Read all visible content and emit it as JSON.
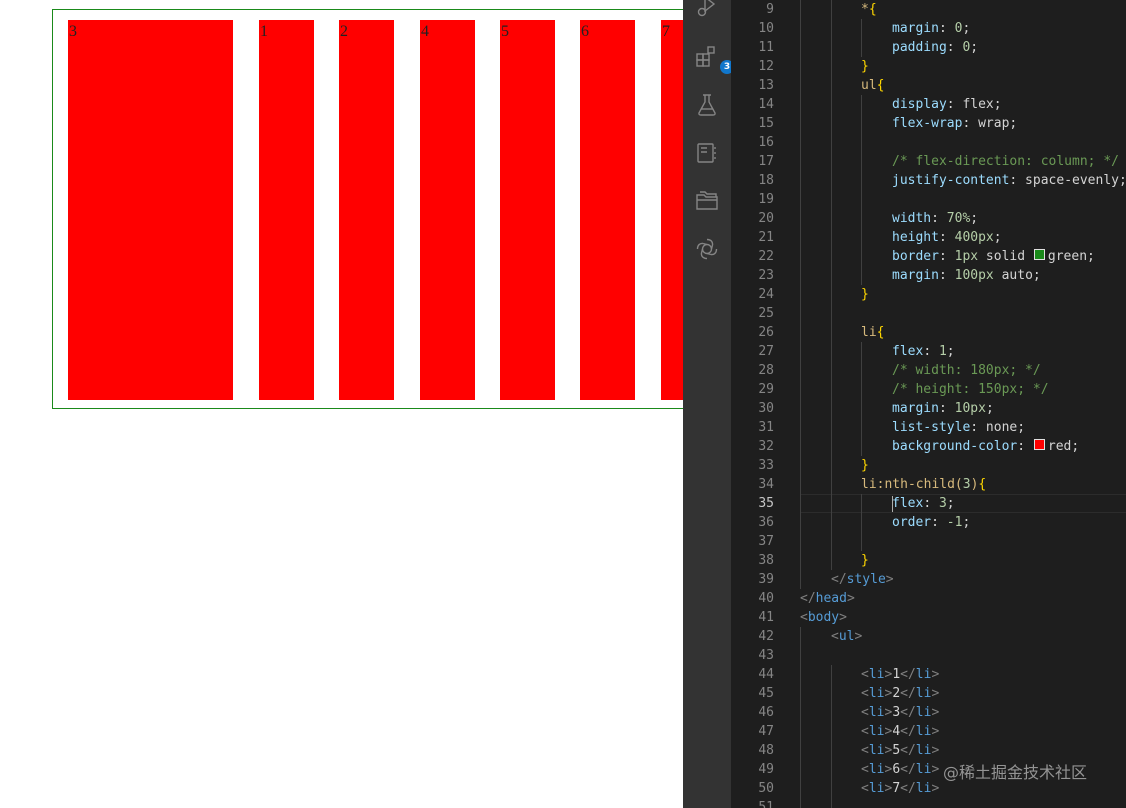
{
  "preview": {
    "items": [
      {
        "label": "3",
        "flex": 3
      },
      {
        "label": "1",
        "flex": 1
      },
      {
        "label": "2",
        "flex": 1
      },
      {
        "label": "4",
        "flex": 1
      },
      {
        "label": "5",
        "flex": 1
      },
      {
        "label": "6",
        "flex": 1
      },
      {
        "label": "7",
        "flex": 1
      }
    ],
    "colors": {
      "item_bg": "#ff0000",
      "border": "#1a8a1a"
    }
  },
  "activity_bar": {
    "icons": [
      "run-debug-icon",
      "extensions-icon",
      "testing-flask-icon",
      "notebook-icon",
      "folder-explorer-icon",
      "openai-chat-icon"
    ],
    "extensions_badge": "3"
  },
  "editor": {
    "active_line": 35,
    "lines": [
      {
        "n": "9",
        "indent": 2,
        "tokens": [
          [
            "sel",
            "*"
          ],
          [
            "brace",
            "{"
          ]
        ]
      },
      {
        "n": "10",
        "indent": 3,
        "tokens": [
          [
            "prop",
            "margin"
          ],
          [
            "val",
            ": "
          ],
          [
            "num",
            "0"
          ],
          [
            "val",
            ";"
          ]
        ]
      },
      {
        "n": "11",
        "indent": 3,
        "tokens": [
          [
            "prop",
            "padding"
          ],
          [
            "val",
            ": "
          ],
          [
            "num",
            "0"
          ],
          [
            "val",
            ";"
          ]
        ]
      },
      {
        "n": "12",
        "indent": 2,
        "tokens": [
          [
            "brace",
            "}"
          ]
        ]
      },
      {
        "n": "13",
        "indent": 2,
        "tokens": [
          [
            "sel",
            "ul"
          ],
          [
            "brace",
            "{"
          ]
        ]
      },
      {
        "n": "14",
        "indent": 3,
        "tokens": [
          [
            "prop",
            "display"
          ],
          [
            "val",
            ": flex;"
          ]
        ]
      },
      {
        "n": "15",
        "indent": 3,
        "tokens": [
          [
            "prop",
            "flex-wrap"
          ],
          [
            "val",
            ": wrap;"
          ]
        ]
      },
      {
        "n": "16",
        "indent": 3,
        "tokens": []
      },
      {
        "n": "17",
        "indent": 3,
        "tokens": [
          [
            "com",
            "/* flex-direction: column; */"
          ]
        ]
      },
      {
        "n": "18",
        "indent": 3,
        "tokens": [
          [
            "prop",
            "justify-content"
          ],
          [
            "val",
            ": space-evenly;"
          ]
        ]
      },
      {
        "n": "19",
        "indent": 3,
        "tokens": []
      },
      {
        "n": "20",
        "indent": 3,
        "tokens": [
          [
            "prop",
            "width"
          ],
          [
            "val",
            ": "
          ],
          [
            "num",
            "70%"
          ],
          [
            "val",
            ";"
          ]
        ]
      },
      {
        "n": "21",
        "indent": 3,
        "tokens": [
          [
            "prop",
            "height"
          ],
          [
            "val",
            ": "
          ],
          [
            "num",
            "400px"
          ],
          [
            "val",
            ";"
          ]
        ]
      },
      {
        "n": "22",
        "indent": 3,
        "tokens": [
          [
            "prop",
            "border"
          ],
          [
            "val",
            ": "
          ],
          [
            "num",
            "1px"
          ],
          [
            "val",
            " solid "
          ],
          [
            "swatch",
            "#1a8a1a"
          ],
          [
            "val",
            "green;"
          ]
        ]
      },
      {
        "n": "23",
        "indent": 3,
        "tokens": [
          [
            "prop",
            "margin"
          ],
          [
            "val",
            ": "
          ],
          [
            "num",
            "100px"
          ],
          [
            "val",
            " auto;"
          ]
        ]
      },
      {
        "n": "24",
        "indent": 2,
        "tokens": [
          [
            "brace",
            "}"
          ]
        ]
      },
      {
        "n": "25",
        "indent": 2,
        "tokens": []
      },
      {
        "n": "26",
        "indent": 2,
        "tokens": [
          [
            "sel",
            "li"
          ],
          [
            "brace",
            "{"
          ]
        ]
      },
      {
        "n": "27",
        "indent": 3,
        "tokens": [
          [
            "prop",
            "flex"
          ],
          [
            "val",
            ": "
          ],
          [
            "num",
            "1"
          ],
          [
            "val",
            ";"
          ]
        ]
      },
      {
        "n": "28",
        "indent": 3,
        "tokens": [
          [
            "com",
            "/* width: 180px; */"
          ]
        ]
      },
      {
        "n": "29",
        "indent": 3,
        "tokens": [
          [
            "com",
            "/* height: 150px; */"
          ]
        ]
      },
      {
        "n": "30",
        "indent": 3,
        "tokens": [
          [
            "prop",
            "margin"
          ],
          [
            "val",
            ": "
          ],
          [
            "num",
            "10px"
          ],
          [
            "val",
            ";"
          ]
        ]
      },
      {
        "n": "31",
        "indent": 3,
        "tokens": [
          [
            "prop",
            "list-style"
          ],
          [
            "val",
            ": none;"
          ]
        ]
      },
      {
        "n": "32",
        "indent": 3,
        "tokens": [
          [
            "prop",
            "background-color"
          ],
          [
            "val",
            ": "
          ],
          [
            "swatch",
            "#ff0000"
          ],
          [
            "val",
            "red;"
          ]
        ]
      },
      {
        "n": "33",
        "indent": 2,
        "tokens": [
          [
            "brace",
            "}"
          ]
        ]
      },
      {
        "n": "34",
        "indent": 2,
        "tokens": [
          [
            "sel",
            "li:nth-child("
          ],
          [
            "num",
            "3"
          ],
          [
            "sel",
            ")"
          ],
          [
            "brace",
            "{"
          ]
        ]
      },
      {
        "n": "35",
        "indent": 3,
        "caret": true,
        "tokens": [
          [
            "prop",
            "flex"
          ],
          [
            "val",
            ": "
          ],
          [
            "num",
            "3"
          ],
          [
            "val",
            ";"
          ]
        ]
      },
      {
        "n": "36",
        "indent": 3,
        "tokens": [
          [
            "prop",
            "order"
          ],
          [
            "val",
            ": "
          ],
          [
            "num",
            "-1"
          ],
          [
            "val",
            ";"
          ]
        ]
      },
      {
        "n": "37",
        "indent": 3,
        "tokens": []
      },
      {
        "n": "38",
        "indent": 2,
        "tokens": [
          [
            "brace",
            "}"
          ]
        ]
      },
      {
        "n": "39",
        "indent": 1,
        "tokens": [
          [
            "punct",
            "</"
          ],
          [
            "tag",
            "style"
          ],
          [
            "punct",
            ">"
          ]
        ]
      },
      {
        "n": "40",
        "indent": 0,
        "tokens": [
          [
            "punct",
            "</"
          ],
          [
            "tag",
            "head"
          ],
          [
            "punct",
            ">"
          ]
        ]
      },
      {
        "n": "41",
        "indent": 0,
        "tokens": [
          [
            "punct",
            "<"
          ],
          [
            "tag",
            "body"
          ],
          [
            "punct",
            ">"
          ]
        ]
      },
      {
        "n": "42",
        "indent": 1,
        "tokens": [
          [
            "punct",
            "<"
          ],
          [
            "tag",
            "ul"
          ],
          [
            "punct",
            ">"
          ]
        ]
      },
      {
        "n": "43",
        "indent": 1,
        "tokens": []
      },
      {
        "n": "44",
        "indent": 2,
        "tokens": [
          [
            "punct",
            "<"
          ],
          [
            "tag",
            "li"
          ],
          [
            "punct",
            ">"
          ],
          [
            "text",
            "1"
          ],
          [
            "punct",
            "</"
          ],
          [
            "tag",
            "li"
          ],
          [
            "punct",
            ">"
          ]
        ]
      },
      {
        "n": "45",
        "indent": 2,
        "tokens": [
          [
            "punct",
            "<"
          ],
          [
            "tag",
            "li"
          ],
          [
            "punct",
            ">"
          ],
          [
            "text",
            "2"
          ],
          [
            "punct",
            "</"
          ],
          [
            "tag",
            "li"
          ],
          [
            "punct",
            ">"
          ]
        ]
      },
      {
        "n": "46",
        "indent": 2,
        "tokens": [
          [
            "punct",
            "<"
          ],
          [
            "tag",
            "li"
          ],
          [
            "punct",
            ">"
          ],
          [
            "text",
            "3"
          ],
          [
            "punct",
            "</"
          ],
          [
            "tag",
            "li"
          ],
          [
            "punct",
            ">"
          ]
        ]
      },
      {
        "n": "47",
        "indent": 2,
        "tokens": [
          [
            "punct",
            "<"
          ],
          [
            "tag",
            "li"
          ],
          [
            "punct",
            ">"
          ],
          [
            "text",
            "4"
          ],
          [
            "punct",
            "</"
          ],
          [
            "tag",
            "li"
          ],
          [
            "punct",
            ">"
          ]
        ]
      },
      {
        "n": "48",
        "indent": 2,
        "tokens": [
          [
            "punct",
            "<"
          ],
          [
            "tag",
            "li"
          ],
          [
            "punct",
            ">"
          ],
          [
            "text",
            "5"
          ],
          [
            "punct",
            "</"
          ],
          [
            "tag",
            "li"
          ],
          [
            "punct",
            ">"
          ]
        ]
      },
      {
        "n": "49",
        "indent": 2,
        "tokens": [
          [
            "punct",
            "<"
          ],
          [
            "tag",
            "li"
          ],
          [
            "punct",
            ">"
          ],
          [
            "text",
            "6"
          ],
          [
            "punct",
            "</"
          ],
          [
            "tag",
            "li"
          ],
          [
            "punct",
            ">"
          ]
        ]
      },
      {
        "n": "50",
        "indent": 2,
        "tokens": [
          [
            "punct",
            "<"
          ],
          [
            "tag",
            "li"
          ],
          [
            "punct",
            ">"
          ],
          [
            "text",
            "7"
          ],
          [
            "punct",
            "</"
          ],
          [
            "tag",
            "li"
          ],
          [
            "punct",
            ">"
          ]
        ]
      },
      {
        "n": "51",
        "indent": 2,
        "tokens": []
      }
    ]
  },
  "watermark": "@稀土掘金技术社区"
}
